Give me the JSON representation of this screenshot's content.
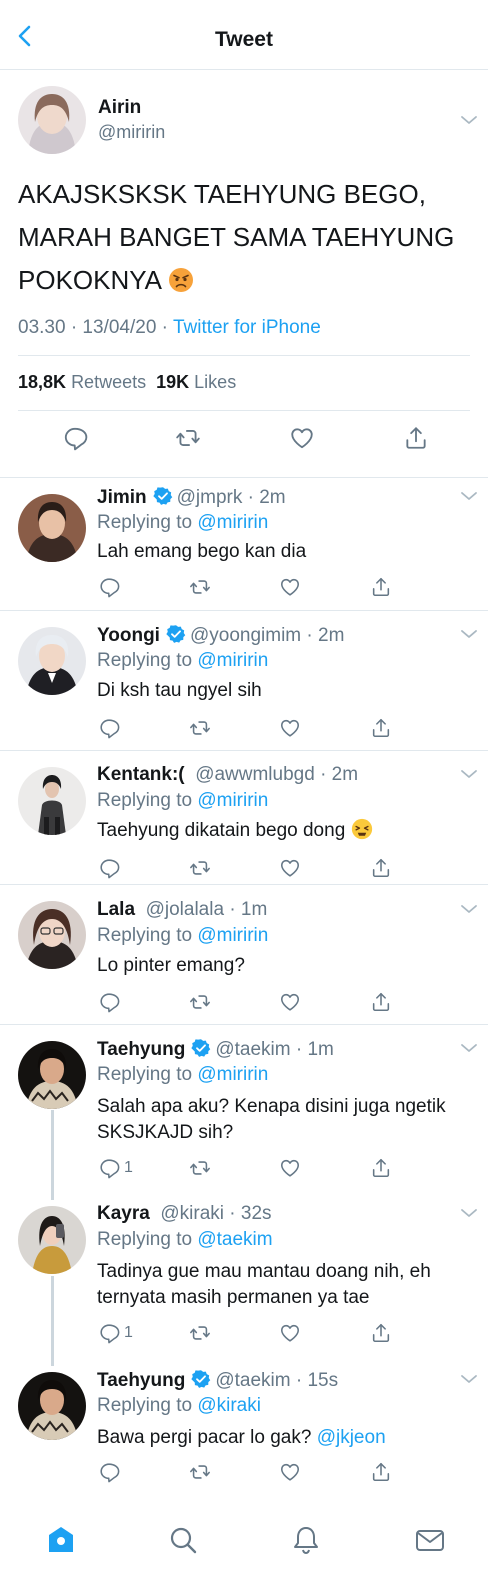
{
  "header": {
    "title": "Tweet",
    "back_icon": "chevron-left-icon",
    "accent": "#1da1f2"
  },
  "main_tweet": {
    "name": "Airin",
    "handle": "@miririn",
    "text": "AKAJSKSKSK TAEHYUNG BEGO, MARAH BANGET SAMA TAEHYUNG POKOKNYA",
    "emoji": "angry-face-emoji",
    "time": "03.30 · 13/04/20 ·",
    "source": "Twitter for iPhone",
    "retweets_count": "18,8K",
    "retweets_label": "Retweets",
    "likes_count": "19K",
    "likes_label": "Likes"
  },
  "replies": [
    {
      "name": "Jimin",
      "verified": true,
      "handle": "@jmprk · 2m",
      "replying_label": "Replying to",
      "replying_to": "@miririn",
      "text": "Lah emang bego kan dia",
      "reply_count": ""
    },
    {
      "name": "Yoongi",
      "verified": true,
      "handle": "@yoongimim · 2m",
      "replying_label": "Replying to",
      "replying_to": "@miririn",
      "text": "Di ksh tau ngyel sih",
      "reply_count": ""
    },
    {
      "name": "Kentank:(",
      "verified": false,
      "handle": "@awwmlubgd · 2m",
      "replying_label": "Replying to",
      "replying_to": "@miririn",
      "text": "Taehyung dikatain bego dong",
      "emoji": "tired-face-emoji",
      "reply_count": ""
    },
    {
      "name": "Lala",
      "verified": false,
      "handle": "@jolalala · 1m",
      "replying_label": "Replying to",
      "replying_to": "@miririn",
      "text": "Lo pinter emang?",
      "reply_count": ""
    },
    {
      "name": "Taehyung",
      "verified": true,
      "handle": "@taekim · 1m",
      "replying_label": "Replying to",
      "replying_to": "@miririn",
      "text_line1": "Salah apa aku? Kenapa disini juga ngetik",
      "text_line2": "SKSJKAJD sih?",
      "reply_count": "1"
    },
    {
      "name": "Kayra",
      "verified": false,
      "handle": "@kiraki · 32s",
      "replying_label": "Replying to",
      "replying_to": "@taekim",
      "text_line1": "Tadinya gue mau mantau doang nih, eh",
      "text_line2": "ternyata masih permanen ya tae",
      "reply_count": "1"
    },
    {
      "name": "Taehyung",
      "verified": true,
      "handle": "@taekim · 15s",
      "replying_label": "Replying to",
      "replying_to": "@kiraki",
      "text": "Bawa pergi pacar lo gak?",
      "text_mention": "@jkjeon",
      "reply_count": ""
    }
  ],
  "tabbar": {
    "items": [
      "home-icon",
      "search-icon",
      "notifications-bell-icon",
      "messages-envelope-icon"
    ]
  }
}
